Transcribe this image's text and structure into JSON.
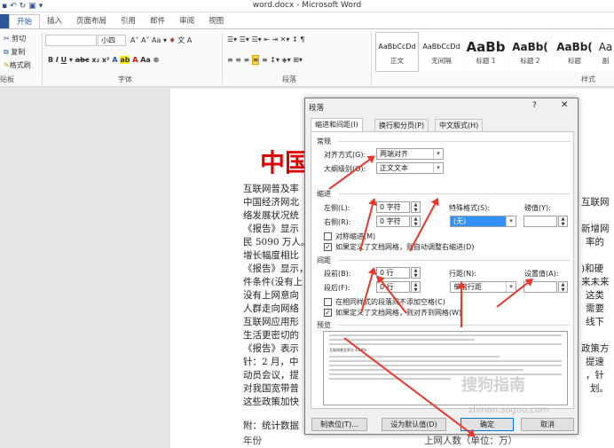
{
  "window": {
    "title": "word.docx - Microsoft Word"
  },
  "tabs": [
    "开始",
    "插入",
    "页面布局",
    "引用",
    "邮件",
    "审阅",
    "视图"
  ],
  "ribbon": {
    "clipboard": {
      "cut": "剪切",
      "copy": "复制",
      "format_painter": "格式刷",
      "label": "贴板"
    },
    "font": {
      "font_name": "",
      "font_size": "小四",
      "label": "字体"
    },
    "paragraph": {
      "label": "段落"
    },
    "styles": {
      "label": "样式",
      "items": [
        {
          "sample": "AaBbCcDd",
          "name": "正文"
        },
        {
          "sample": "AaBbCcDd",
          "name": "无间隔"
        },
        {
          "sample": "AaBb",
          "name": "标题 1"
        },
        {
          "sample": "AaBb(",
          "name": "标题 2"
        },
        {
          "sample": "AaBb(",
          "name": "标题"
        },
        {
          "sample": "Aa",
          "name": "副"
        }
      ]
    }
  },
  "document": {
    "title": "中国",
    "lines": [
      "互联网普及率",
      "中国经济网北",
      "络发展状况统",
      "《报告》显示",
      "民 5090 万人。",
      "增长幅度相比",
      "《报告》显示，",
      "件条件(没有上",
      "没有上网意向",
      "人群走向网络",
      "互联网应用形",
      "生活更密切的",
      "《报告》表示",
      "针：2 月，中",
      "动员会议，提",
      "对我国宽带普",
      "这些政策加快"
    ],
    "right_fragments": [
      "互联网",
      "新增网",
      "率的",
      ")和硬",
      "来未来",
      "这类",
      "需要",
      "线下",
      "政策方",
      "提速",
      "，针",
      "划。"
    ],
    "footer_line": "附：统计数据",
    "table_col1": "年份",
    "table_col2": "上网人数（单位：万）"
  },
  "dialog": {
    "title": "段落",
    "help": "?",
    "close": "✕",
    "tabs": [
      "缩进和间距(I)",
      "换行和分页(P)",
      "中文版式(H)"
    ],
    "general": {
      "heading": "常规",
      "alignment_label": "对齐方式(G):",
      "alignment_value": "两端对齐",
      "outline_label": "大纲级别(O):",
      "outline_value": "正文文本"
    },
    "indent": {
      "heading": "缩进",
      "left_label": "左侧(L):",
      "left_value": "0 字符",
      "right_label": "右侧(R):",
      "right_value": "0 字符",
      "special_label": "特殊格式(S):",
      "special_value": "(无)",
      "by_label": "磅值(Y):",
      "by_value": "",
      "mirror_label": "对称缩进(M)",
      "mirror_checked": false,
      "auto_adjust_label": "如果定义了文档网格，则自动调整右缩进(D)",
      "auto_adjust_checked": true
    },
    "spacing": {
      "heading": "间距",
      "before_label": "段前(B):",
      "before_value": "0 行",
      "after_label": "段后(F):",
      "after_value": "0 行",
      "line_label": "行距(N):",
      "line_value": "单倍行距",
      "at_label": "设置值(A):",
      "at_value": "",
      "no_space_label": "在相同样式的段落间不添加空格(C)",
      "no_space_checked": false,
      "snap_grid_label": "如果定义了文档网格，则对齐到网格(W)",
      "snap_grid_checked": true
    },
    "preview": {
      "heading": "预览",
      "sample_text": "互联网普及率为 45.8%"
    },
    "buttons": {
      "tabs": "制表位(T)...",
      "default": "设为默认值(D)",
      "ok": "确定",
      "cancel": "取消"
    }
  },
  "watermark": {
    "text": "搜狗指南",
    "url": "zhinan.sogou.com"
  },
  "colors": {
    "accent": "#2b579a",
    "title_red": "#e00000",
    "arrow_red": "#e8362b"
  }
}
